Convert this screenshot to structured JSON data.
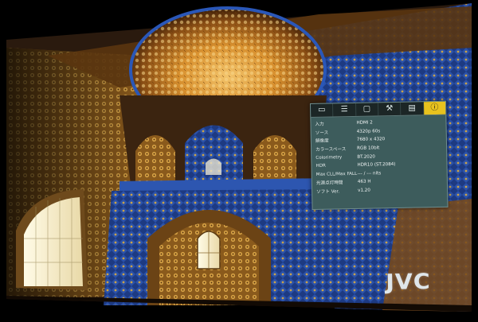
{
  "osd": {
    "tabs": [
      {
        "icon": "picture-icon",
        "glyph": "▭"
      },
      {
        "icon": "sliders-icon",
        "glyph": "☰"
      },
      {
        "icon": "display-icon",
        "glyph": "▢"
      },
      {
        "icon": "wrench-icon",
        "glyph": "⚒"
      },
      {
        "icon": "hdmi-icon",
        "glyph": "▤"
      },
      {
        "icon": "info-icon",
        "glyph": "ⓘ",
        "active": true
      }
    ],
    "rows": [
      {
        "label": "入力",
        "value": "HDMI 2"
      },
      {
        "label": "ソース",
        "value": "4320p 60s"
      },
      {
        "label": "解像度",
        "value": "7680 x 4320"
      },
      {
        "label": "カラースペース",
        "value": "RGB 10bit"
      },
      {
        "label": "Colorimetry",
        "value": "BT.2020"
      },
      {
        "label": "HDR",
        "value": "HDR10 (ST.2084)"
      },
      {
        "label": "Max CLL/Max FALL",
        "value": "--- / --- nits"
      },
      {
        "label": "光源点灯時間",
        "value": "463 H"
      },
      {
        "label": "ソフト Ver.",
        "value": "v1.20"
      }
    ]
  },
  "logo": {
    "text": "JVC",
    "icon": "jvc-logo"
  },
  "colors": {
    "osd_bg": "#3d5c5c",
    "osd_active_tab": "#e8c21e",
    "tile_blue": "#1f3f8a",
    "gold": "#d89a3a"
  }
}
